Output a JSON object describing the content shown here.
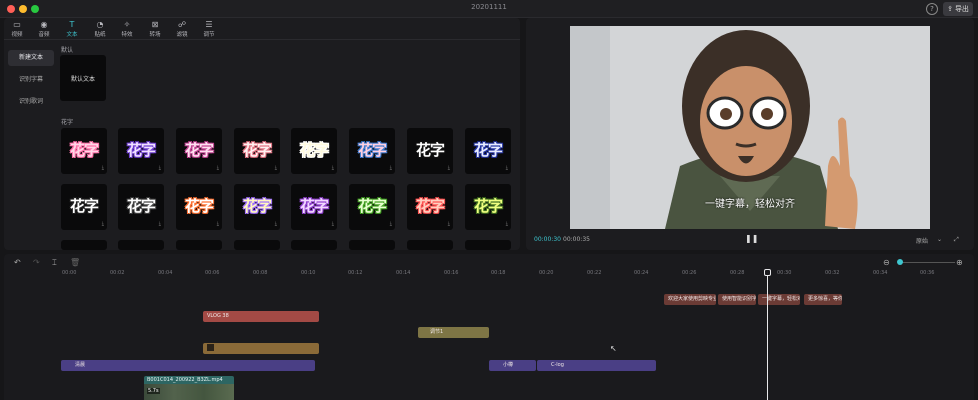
{
  "app": {
    "title": "20201111",
    "export_label": "导出",
    "help_label": "?"
  },
  "toolbar": {
    "items": [
      {
        "label": "视频",
        "icon": "video-icon"
      },
      {
        "label": "音频",
        "icon": "audio-icon"
      },
      {
        "label": "文本",
        "icon": "text-icon",
        "active": true
      },
      {
        "label": "贴纸",
        "icon": "sticker-icon"
      },
      {
        "label": "特效",
        "icon": "effects-icon"
      },
      {
        "label": "转场",
        "icon": "transition-icon"
      },
      {
        "label": "滤镜",
        "icon": "filter-icon"
      },
      {
        "label": "调节",
        "icon": "adjust-icon"
      }
    ]
  },
  "sidenav": {
    "items": [
      "新建文本",
      "识别字幕",
      "识别歌词"
    ]
  },
  "sections": {
    "default": "默认",
    "huazi": "花字"
  },
  "default_text_tile": "默认文本",
  "huazi_text": "花字",
  "preview": {
    "subtitle": "一键字幕，轻松对齐",
    "current_time": "00:00:30",
    "total_time": "00:00:35",
    "ratio_label": "原始"
  },
  "timeline": {
    "ticks": [
      "00:00",
      "00:02",
      "00:04",
      "00:06",
      "00:08",
      "00:10",
      "00:12",
      "00:14",
      "00:16",
      "00:18",
      "00:20",
      "00:22",
      "00:24",
      "00:26",
      "00:28",
      "00:30",
      "00:32",
      "00:34",
      "00:36"
    ],
    "clips": {
      "caption1": "欢迎大家使用剪映专业版",
      "caption2": "使用智能识别字幕",
      "caption3": "一键字幕，轻松对齐",
      "caption4": "更多惊喜，等你来发现",
      "vlog": "VLOG 38",
      "adjust": "调节1",
      "filter1": "清晨",
      "filter2": "小樽",
      "filter3": "C-log",
      "video_name": "B001C014_200922_B3ZL.mp4",
      "video_duration": "5.7s"
    }
  },
  "colors": {
    "accent": "#3ec6d0",
    "caption": "#6b3b35",
    "vlog": "#a34a45",
    "adjust": "#7e7545",
    "sticker": "#8a6a38",
    "filter": "#4a3f85",
    "video": "#2d6663"
  }
}
